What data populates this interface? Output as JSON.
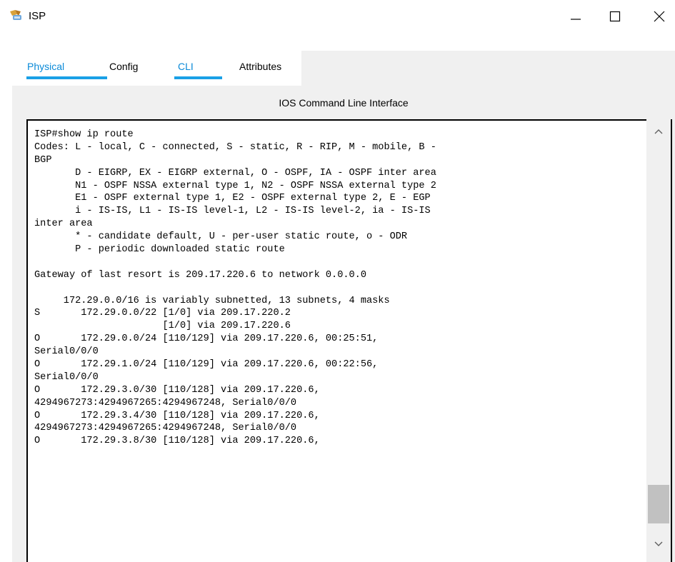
{
  "window": {
    "title": "ISP"
  },
  "tabs": [
    {
      "label": "Physical",
      "active": true
    },
    {
      "label": "Config",
      "active": false
    },
    {
      "label": "CLI",
      "active": true
    },
    {
      "label": "Attributes",
      "active": false
    }
  ],
  "cli": {
    "heading": "IOS Command Line Interface",
    "lines": [
      "ISP#show ip route",
      "Codes: L - local, C - connected, S - static, R - RIP, M - mobile, B -",
      "BGP",
      "       D - EIGRP, EX - EIGRP external, O - OSPF, IA - OSPF inter area",
      "       N1 - OSPF NSSA external type 1, N2 - OSPF NSSA external type 2",
      "       E1 - OSPF external type 1, E2 - OSPF external type 2, E - EGP",
      "       i - IS-IS, L1 - IS-IS level-1, L2 - IS-IS level-2, ia - IS-IS",
      "inter area",
      "       * - candidate default, U - per-user static route, o - ODR",
      "       P - periodic downloaded static route",
      "",
      "Gateway of last resort is 209.17.220.6 to network 0.0.0.0",
      "",
      "     172.29.0.0/16 is variably subnetted, 13 subnets, 4 masks",
      "S       172.29.0.0/22 [1/0] via 209.17.220.2",
      "                      [1/0] via 209.17.220.6",
      "O       172.29.0.0/24 [110/129] via 209.17.220.6, 00:25:51,",
      "Serial0/0/0",
      "O       172.29.1.0/24 [110/129] via 209.17.220.6, 00:22:56,",
      "Serial0/0/0",
      "O       172.29.3.0/30 [110/128] via 209.17.220.6,",
      "4294967273:4294967265:4294967248, Serial0/0/0",
      "O       172.29.3.4/30 [110/128] via 209.17.220.6,",
      "4294967273:4294967265:4294967248, Serial0/0/0",
      "O       172.29.3.8/30 [110/128] via 209.17.220.6,"
    ],
    "scroll_position": 0.9
  },
  "icons": {
    "app": "router-app-icon",
    "minimize": "minimize-icon",
    "maximize": "maximize-icon",
    "close": "close-icon",
    "scroll_up": "chevron-up-icon",
    "scroll_down": "chevron-down-icon"
  },
  "colors": {
    "tab_active": "#0a8ad8",
    "tab_underline": "#1aa0e6",
    "panel_bg": "#f0f0f0"
  }
}
